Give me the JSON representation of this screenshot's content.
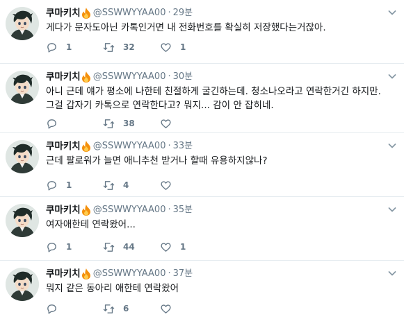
{
  "colors": {
    "text": "#14171a",
    "secondary": "#657786",
    "divider": "#e6ecf0",
    "fire": "#f4900c"
  },
  "user": {
    "name": "쿠마키치",
    "handle": "@SSWWYYAA00",
    "separator": "·",
    "badge_icon": "fire-icon"
  },
  "tweets": [
    {
      "time": "29분",
      "text": "게다가 문자도아닌 카톡인거면 내 전화번호를 확실히 저장했다는거잖아.",
      "reply_count": "1",
      "retweet_count": "32",
      "like_count": "1"
    },
    {
      "time": "30분",
      "text": "아니 근데 얘가 평소에 나한테 친절하게 굴긴하는데. 청소나오라고 연락한거긴 하지만. 그걸 갑자기 카톡으로 연락한다고? 뭐지... 감이 안 잡히네.",
      "reply_count": "",
      "retweet_count": "38",
      "like_count": ""
    },
    {
      "time": "33분",
      "text": "근데 팔로워가 늘면 애니추천 받거나 할때 유용하지않나?",
      "reply_count": "1",
      "retweet_count": "4",
      "like_count": ""
    },
    {
      "time": "35분",
      "text": "여자애한테 연락왔어...",
      "reply_count": "1",
      "retweet_count": "44",
      "like_count": "1"
    },
    {
      "time": "37분",
      "text": "뭐지 같은 동아리 애한테 연락왔어",
      "reply_count": "",
      "retweet_count": "6",
      "like_count": ""
    }
  ]
}
